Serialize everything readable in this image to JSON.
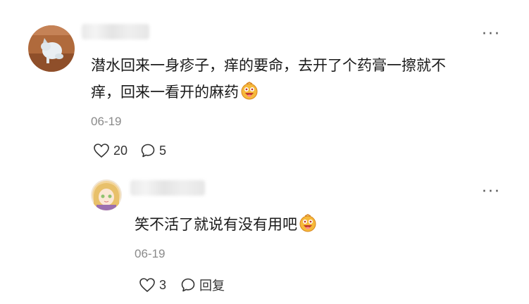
{
  "comments": [
    {
      "date": "06-19",
      "text_line1": "潜水回来一身疹子，痒的要命，去开了个药膏一擦就不",
      "text_line2": "痒，回来一看开的麻药",
      "emoji": "laughing-emoji",
      "likes": "20",
      "replies": "5",
      "more": "···"
    }
  ],
  "reply": {
    "date": "06-19",
    "text": "笑不活了就说有没有用吧",
    "emoji": "laughing-emoji",
    "likes": "3",
    "reply_label": "回复",
    "more": "···"
  },
  "colors": {
    "text": "#1a1a1a",
    "meta": "#8a8a8a",
    "icon": "#333333"
  }
}
